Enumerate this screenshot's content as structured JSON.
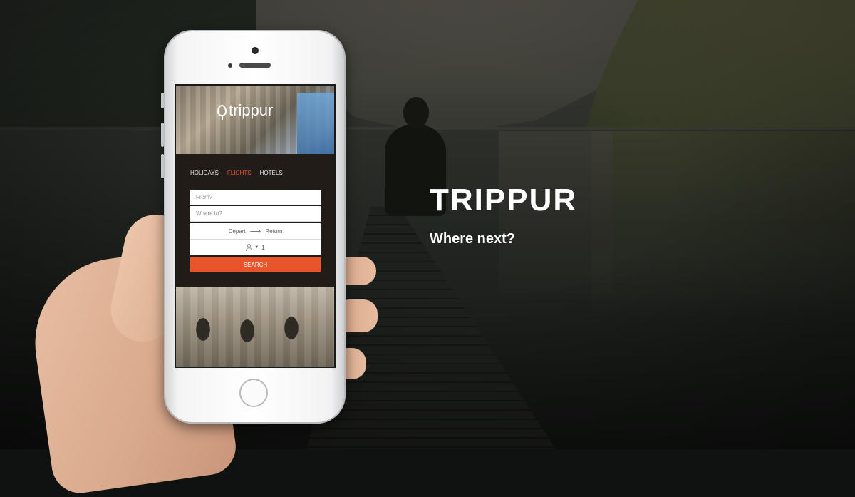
{
  "headline": {
    "title": "TRIPPUR",
    "tagline": "Where next?"
  },
  "app": {
    "logo_text": "trippur",
    "logo_icon": "location-pin-icon",
    "tabs": [
      {
        "label": "HOLIDAYS",
        "active": false
      },
      {
        "label": "FLIGHTS",
        "active": true
      },
      {
        "label": "HOTELS",
        "active": false
      }
    ],
    "form": {
      "from_placeholder": "From?",
      "to_placeholder": "Where to?",
      "depart_label": "Depart",
      "return_label": "Return",
      "arrow_icon": "arrow-right-icon",
      "traveller_icon": "person-icon",
      "traveller_count": "1",
      "search_label": "SEARCH"
    },
    "colors": {
      "accent": "#e8552b",
      "panel_bg": "#221c18"
    }
  }
}
